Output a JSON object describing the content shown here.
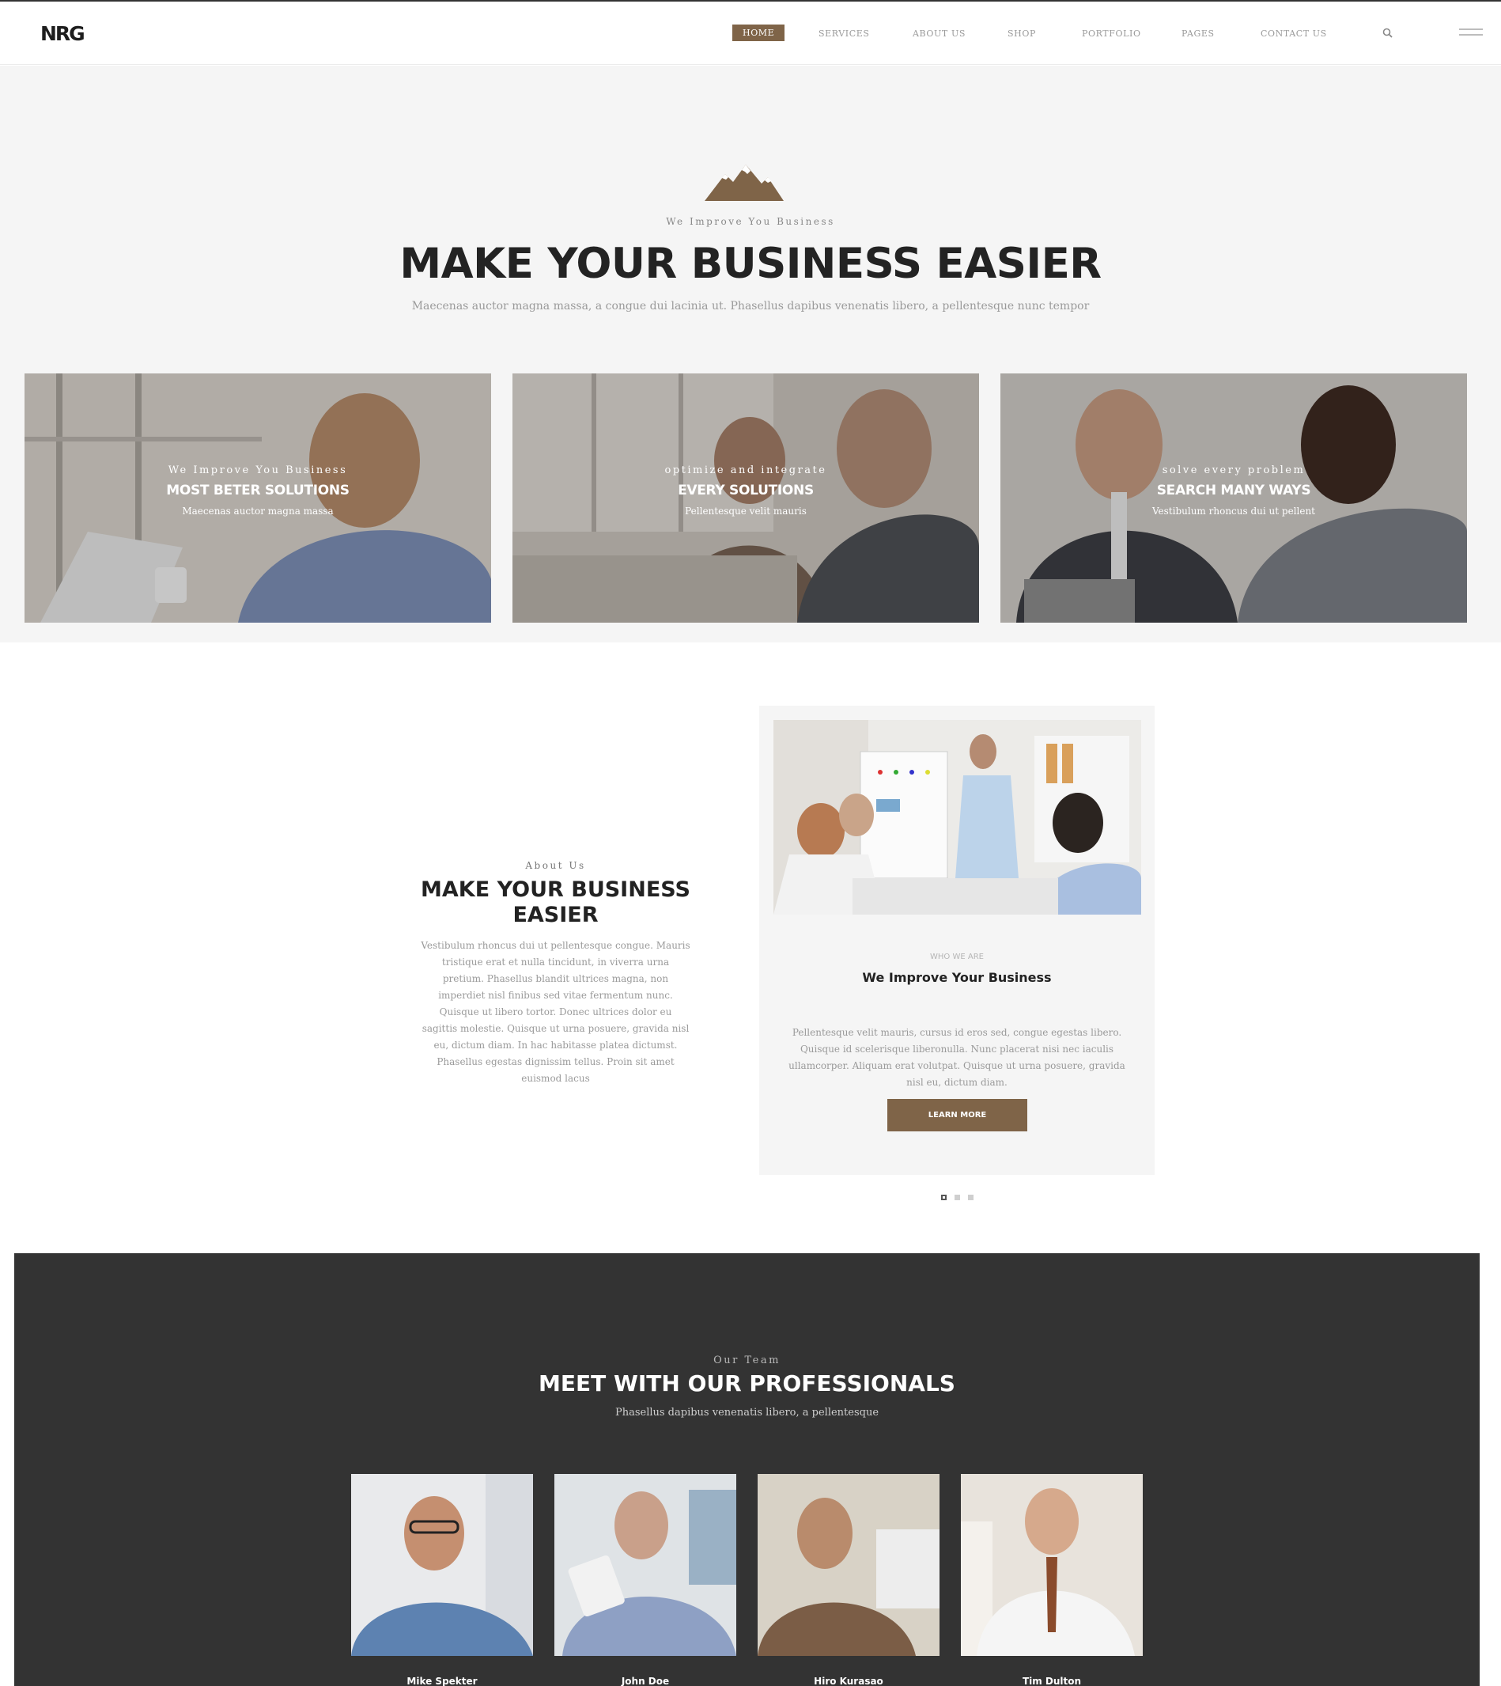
{
  "header": {
    "logo": "NRG",
    "nav": [
      {
        "label": "HOME",
        "active": true
      },
      {
        "label": "SERVICES",
        "active": false
      },
      {
        "label": "ABOUT US",
        "active": false
      },
      {
        "label": "SHOP",
        "active": false
      },
      {
        "label": "PORTFOLIO",
        "active": false
      },
      {
        "label": "PAGES",
        "active": false
      },
      {
        "label": "CONTACT US",
        "active": false
      }
    ],
    "icons": {
      "search": "search-icon",
      "menu": "hamburger-menu-icon"
    }
  },
  "hero": {
    "icon": "mountain-icon",
    "eyebrow": "We Improve You Business",
    "title": "MAKE YOUR BUSINESS EASIER",
    "subtitle": "Maecenas auctor magna massa, a congue dui lacinia ut. Phasellus dapibus venenatis libero, a pellentesque nunc tempor"
  },
  "cards": [
    {
      "eyebrow": "We Improve You Business",
      "title": "MOST BETER SOLUTIONS",
      "subtitle": "Maecenas auctor magna massa"
    },
    {
      "eyebrow": "optimize and integrate",
      "title": "EVERY SOLUTIONS",
      "subtitle": "Pellentesque velit mauris"
    },
    {
      "eyebrow": "solve every problem",
      "title": "SEARCH MANY WAYS",
      "subtitle": "Vestibulum rhoncus dui ut pellent"
    }
  ],
  "about": {
    "eyebrow": "About Us",
    "title": "MAKE YOUR BUSINESS EASIER",
    "body": "Vestibulum rhoncus dui ut pellentesque congue. Mauris tristique erat et nulla tincidunt, in viverra urna pretium. Phasellus blandit ultrices magna, non imperdiet nisl finibus sed vitae fermentum nunc. Quisque ut libero tortor. Donec ultrices dolor eu sagittis molestie. Quisque ut urna posuere, gravida nisl eu, dictum diam. In hac habitasse platea dictumst. Phasellus egestas dignissim tellus. Proin sit amet euismod lacus"
  },
  "slider": {
    "eyebrow": "WHO WE ARE",
    "title": "We Improve Your Business",
    "body": "Pellentesque velit mauris, cursus id eros sed, congue egestas libero. Quisque id scelerisque liberonulla. Nunc placerat nisi nec iaculis ullamcorper. Aliquam erat volutpat. Quisque ut urna posuere, gravida nisl eu, dictum diam.",
    "button": "LEARN MORE",
    "slide_count": 3,
    "active_slide": 1
  },
  "team": {
    "eyebrow": "Our Team",
    "title": "MEET WITH OUR PROFESSIONALS",
    "subtitle": "Phasellus dapibus venenatis libero, a pellentesque",
    "members": [
      {
        "name": "Mike Spekter"
      },
      {
        "name": "John Doe"
      },
      {
        "name": "Hiro Kurasao"
      },
      {
        "name": "Tim Dulton"
      }
    ]
  },
  "colors": {
    "accent": "#7f6448",
    "dark": "#333333",
    "hero_bg": "#f5f5f5"
  }
}
